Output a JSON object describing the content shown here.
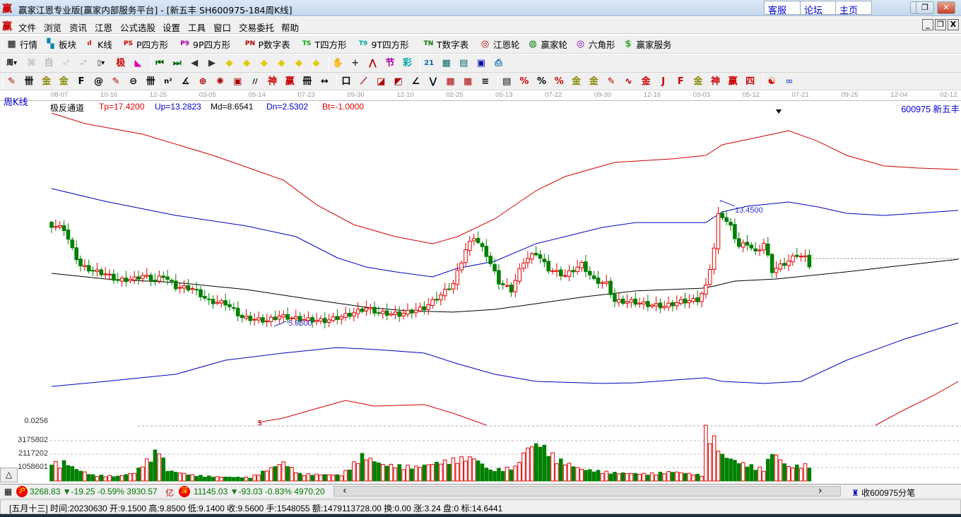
{
  "window": {
    "logo": "赢",
    "title": "赢家江恩专业版[赢家内部服务平台] - [新五丰  SH600975-184周K线]",
    "links": [
      "客服",
      "论坛",
      "主页"
    ],
    "controls": [
      "—",
      "❐",
      "✕"
    ]
  },
  "menu": {
    "logo": "赢",
    "items": [
      "文件",
      "浏览",
      "资讯",
      "江恩",
      "公式选股",
      "设置",
      "工具",
      "窗口",
      "交易委托",
      "帮助"
    ],
    "mdi": [
      "_",
      "❐",
      "X"
    ]
  },
  "toolbar1": [
    {
      "icon": "grid-icon",
      "glyph": "▦",
      "color": "#000",
      "label": "行情"
    },
    {
      "icon": "blocks-icon",
      "glyph": "▚",
      "color": "#08a",
      "label": "板块"
    },
    {
      "icon": "kline-icon",
      "glyph": "ıl",
      "color": "#c00",
      "label": "K线"
    },
    {
      "icon": "ps-icon",
      "glyph": "PS",
      "color": "#c00",
      "label": "P四方形"
    },
    {
      "icon": "p9-icon",
      "glyph": "P9",
      "color": "#a0a",
      "label": "9P四方形"
    },
    {
      "icon": "pn-icon",
      "glyph": "PN",
      "color": "#a00",
      "label": "P数字表"
    },
    {
      "icon": "ts-icon",
      "glyph": "TS",
      "color": "#0a0",
      "label": "T四方形"
    },
    {
      "icon": "t9-icon",
      "glyph": "T9",
      "color": "#0aa",
      "label": "9T四方形"
    },
    {
      "icon": "tn-icon",
      "glyph": "TN",
      "color": "#070",
      "label": "T数字表"
    },
    {
      "icon": "target-icon",
      "glyph": "◎",
      "color": "#a00",
      "label": "江恩轮"
    },
    {
      "icon": "wheel-icon",
      "glyph": "◍",
      "color": "#070",
      "label": "赢家轮"
    },
    {
      "icon": "hexagon-icon",
      "glyph": "◎",
      "color": "#70a",
      "label": "六角形"
    },
    {
      "icon": "dollar-icon",
      "glyph": "$",
      "color": "#3a3",
      "label": "赢家服务"
    }
  ],
  "toolbar2": [
    {
      "icon": "period-week-icon",
      "glyph": "周▾",
      "color": "#000"
    },
    {
      "icon": "disabled-icon",
      "glyph": "⌘",
      "color": "#bbb"
    },
    {
      "icon": "disabled-icon",
      "glyph": "自",
      "color": "#bbb"
    },
    {
      "icon": "disabled-icon",
      "glyph": "ₙ³",
      "color": "#bbb"
    },
    {
      "icon": "disabled-icon",
      "glyph": "ₙ⁹",
      "color": "#bbb"
    },
    {
      "icon": "candle-type-icon",
      "glyph": "▯▾",
      "color": "#000"
    },
    {
      "icon": "extreme-icon",
      "glyph": "极",
      "color": "#c00"
    },
    {
      "icon": "spectrum-icon",
      "glyph": "◣",
      "color": "#d0a"
    },
    {
      "icon": "first-icon",
      "glyph": "⏮",
      "color": "#060"
    },
    {
      "icon": "last-icon",
      "glyph": "⏭",
      "color": "#060"
    },
    {
      "icon": "left-icon",
      "glyph": "◀",
      "color": "#333"
    },
    {
      "icon": "right-icon",
      "glyph": "▶",
      "color": "#333"
    },
    {
      "icon": "diamond-left-icon",
      "glyph": "◆",
      "color": "#dc0"
    },
    {
      "icon": "diamond-right-icon",
      "glyph": "◆",
      "color": "#dc0"
    },
    {
      "icon": "diamond-expand-icon",
      "glyph": "◆",
      "color": "#dc0"
    },
    {
      "icon": "diamond-shrink-icon",
      "glyph": "◆",
      "color": "#dc0"
    },
    {
      "icon": "diamond-vshrink-icon",
      "glyph": "◆",
      "color": "#dc0"
    },
    {
      "icon": "diamond-move-icon",
      "glyph": "◆",
      "color": "#dc0"
    },
    {
      "icon": "hand-icon",
      "glyph": "✋",
      "color": "#333"
    },
    {
      "icon": "crosshair-icon",
      "glyph": "+",
      "color": "#333"
    },
    {
      "icon": "peak-icon",
      "glyph": "⋀",
      "color": "#a00"
    },
    {
      "icon": "section-icon",
      "glyph": "节",
      "color": "#a0a"
    },
    {
      "icon": "color-icon",
      "glyph": "彩",
      "color": "#0aa"
    },
    {
      "icon": "calendar-icon",
      "glyph": "21",
      "color": "#06a"
    },
    {
      "icon": "calculator-icon",
      "glyph": "▦",
      "color": "#066"
    },
    {
      "icon": "notes-icon",
      "glyph": "▤",
      "color": "#066"
    },
    {
      "icon": "save-icon",
      "glyph": "▣",
      "color": "#00a"
    },
    {
      "icon": "print-icon",
      "glyph": "⎙",
      "color": "#06a"
    }
  ],
  "toolbar3": [
    {
      "icon": "pen-icon",
      "glyph": "✎",
      "color": "#a00"
    },
    {
      "icon": "lines-icon",
      "glyph": "卌",
      "color": "#000"
    },
    {
      "icon": "gold-icon",
      "glyph": "金",
      "color": "#880"
    },
    {
      "icon": "gold2-icon",
      "glyph": "金",
      "color": "#880"
    },
    {
      "icon": "fib-icon",
      "glyph": "F",
      "color": "#000"
    },
    {
      "icon": "spiral-icon",
      "glyph": "@",
      "color": "#000"
    },
    {
      "icon": "pen2-icon",
      "glyph": "✎",
      "color": "#a00"
    },
    {
      "icon": "circle-scale-icon",
      "glyph": "⊖",
      "color": "#000"
    },
    {
      "icon": "lines2-icon",
      "glyph": "卌",
      "color": "#000"
    },
    {
      "icon": "n2-icon",
      "glyph": "n²",
      "color": "#000"
    },
    {
      "icon": "angle-icon",
      "glyph": "∡",
      "color": "#000"
    },
    {
      "icon": "cycle-icon",
      "glyph": "⊕",
      "color": "#a00"
    },
    {
      "icon": "radar-icon",
      "glyph": "✺",
      "color": "#a00"
    },
    {
      "icon": "square-icon",
      "glyph": "▣",
      "color": "#a00"
    },
    {
      "icon": "slash-icon",
      "glyph": "//",
      "color": "#000"
    },
    {
      "icon": "god-icon",
      "glyph": "神",
      "color": "#c00"
    },
    {
      "icon": "win-icon",
      "glyph": "赢",
      "color": "#c00"
    },
    {
      "icon": "comb-icon",
      "glyph": "冊",
      "color": "#000"
    },
    {
      "icon": "span-icon",
      "glyph": "↔",
      "color": "#000"
    },
    {
      "icon": "box-icon",
      "glyph": "口",
      "color": "#000"
    },
    {
      "icon": "fan-icon",
      "glyph": "⟋",
      "color": "#a00"
    },
    {
      "icon": "arc-icon",
      "glyph": "◪",
      "color": "#a00"
    },
    {
      "icon": "box-fan-icon",
      "glyph": "◩",
      "color": "#a00"
    },
    {
      "icon": "angle2-icon",
      "glyph": "∠",
      "color": "#000"
    },
    {
      "icon": "zigzag-icon",
      "glyph": "⋁",
      "color": "#000"
    },
    {
      "icon": "grid-icon",
      "glyph": "▦",
      "color": "#a00"
    },
    {
      "icon": "grid2-icon",
      "glyph": "▦",
      "color": "#a00"
    },
    {
      "icon": "parallel-icon",
      "glyph": "≡",
      "color": "#000"
    },
    {
      "icon": "table-icon",
      "glyph": "▤",
      "color": "#000"
    },
    {
      "icon": "pct-red-icon",
      "glyph": "%",
      "color": "#c00"
    },
    {
      "icon": "pct-icon",
      "glyph": "%",
      "color": "#000"
    },
    {
      "icon": "pct-lines-icon",
      "glyph": "%",
      "color": "#c00"
    },
    {
      "icon": "gold-circle-icon",
      "glyph": "金",
      "color": "#880"
    },
    {
      "icon": "gold-lines-icon",
      "glyph": "金",
      "color": "#880"
    },
    {
      "icon": "pen3-icon",
      "glyph": "✎",
      "color": "#a00"
    },
    {
      "icon": "wave-icon",
      "glyph": "∿",
      "color": "#a00"
    },
    {
      "icon": "gold-bar-icon",
      "glyph": "金",
      "color": "#c00"
    },
    {
      "icon": "j-fan-icon",
      "glyph": "J",
      "color": "#c00"
    },
    {
      "icon": "f-fan-icon",
      "glyph": "F",
      "color": "#c00"
    },
    {
      "icon": "gold-fan-icon",
      "glyph": "金",
      "color": "#880"
    },
    {
      "icon": "god-fan-icon",
      "glyph": "神",
      "color": "#c00"
    },
    {
      "icon": "win-fan-icon",
      "glyph": "赢",
      "color": "#c00"
    },
    {
      "icon": "four-fan-icon",
      "glyph": "四",
      "color": "#c00"
    },
    {
      "icon": "yinyang-icon",
      "glyph": "☯",
      "color": "#c00"
    },
    {
      "icon": "infinity-icon",
      "glyph": "∞",
      "color": "#36c"
    }
  ],
  "date_axis": [
    "08-07",
    "10-16",
    "12-25",
    "03-05",
    "05-14",
    "07-23",
    "09-30",
    "12-10",
    "02-25",
    "05-13",
    "07-22",
    "09-30",
    "12-16",
    "03-03",
    "05-12",
    "07-21",
    "09-25",
    "12-04",
    "02-12"
  ],
  "period_label": "周K线",
  "indicator": {
    "name": "极反通道",
    "tp": "Tp=17.4200",
    "up": "Up=13.2823",
    "md": "Md=8.6541",
    "dn": "Dn=2.5302",
    "bt": "Bt=-1.0000"
  },
  "stock": "600975  新五丰",
  "colors": {
    "up": "#e00000",
    "down": "#008000",
    "tp": "#d00000",
    "upline": "#0000c0",
    "md": "#000000"
  },
  "chart_data": {
    "type": "candlestick",
    "weeks": 184,
    "close_keypoints": [
      [
        0,
        12.0
      ],
      [
        3,
        11.8
      ],
      [
        5,
        10.5
      ],
      [
        7,
        9.5
      ],
      [
        10,
        9.2
      ],
      [
        13,
        9.0
      ],
      [
        16,
        8.6
      ],
      [
        20,
        8.7
      ],
      [
        22,
        8.9
      ],
      [
        25,
        8.6
      ],
      [
        27,
        8.9
      ],
      [
        30,
        8.2
      ],
      [
        34,
        8.1
      ],
      [
        38,
        7.3
      ],
      [
        42,
        7.2
      ],
      [
        46,
        6.3
      ],
      [
        52,
        6.1
      ],
      [
        55,
        6.4
      ],
      [
        60,
        6.2
      ],
      [
        66,
        6.1
      ],
      [
        72,
        6.5
      ],
      [
        76,
        6.9
      ],
      [
        79,
        6.6
      ],
      [
        84,
        6.5
      ],
      [
        90,
        6.9
      ],
      [
        94,
        7.7
      ],
      [
        97,
        8.4
      ],
      [
        100,
        10.5
      ],
      [
        102,
        11.3
      ],
      [
        105,
        10.2
      ],
      [
        108,
        8.5
      ],
      [
        111,
        8.0
      ],
      [
        114,
        9.8
      ],
      [
        117,
        10.3
      ],
      [
        120,
        9.3
      ],
      [
        124,
        8.9
      ],
      [
        128,
        9.6
      ],
      [
        131,
        8.6
      ],
      [
        134,
        8.4
      ],
      [
        136,
        7.3
      ],
      [
        140,
        7.3
      ],
      [
        144,
        7.1
      ],
      [
        148,
        7.0
      ],
      [
        152,
        7.3
      ],
      [
        156,
        7.4
      ],
      [
        158,
        8.2
      ],
      [
        160,
        10.6
      ],
      [
        161,
        12.6
      ],
      [
        162,
        12.6
      ],
      [
        164,
        11.9
      ],
      [
        166,
        10.7
      ],
      [
        168,
        10.9
      ],
      [
        170,
        10.3
      ],
      [
        172,
        10.9
      ],
      [
        174,
        9.2
      ],
      [
        176,
        9.5
      ],
      [
        178,
        9.8
      ],
      [
        180,
        10.2
      ],
      [
        182,
        10.0
      ],
      [
        183,
        9.56
      ]
    ],
    "volume_keypoints": [
      [
        0,
        1800000
      ],
      [
        2,
        1300000
      ],
      [
        3,
        1650000
      ],
      [
        6,
        1000000
      ],
      [
        10,
        500000
      ],
      [
        16,
        400000
      ],
      [
        20,
        700000
      ],
      [
        26,
        2800000
      ],
      [
        28,
        900000
      ],
      [
        34,
        500000
      ],
      [
        40,
        350000
      ],
      [
        48,
        300000
      ],
      [
        56,
        1600000
      ],
      [
        60,
        600000
      ],
      [
        70,
        500000
      ],
      [
        75,
        2200000
      ],
      [
        80,
        1400000
      ],
      [
        88,
        1200000
      ],
      [
        98,
        1900000
      ],
      [
        102,
        2000000
      ],
      [
        106,
        900000
      ],
      [
        112,
        1200000
      ],
      [
        115,
        2900000
      ],
      [
        118,
        3200000
      ],
      [
        122,
        1900000
      ],
      [
        128,
        1000000
      ],
      [
        136,
        700000
      ],
      [
        144,
        600000
      ],
      [
        150,
        800000
      ],
      [
        157,
        500000
      ],
      [
        158,
        4400000
      ],
      [
        160,
        3600000
      ],
      [
        162,
        2200000
      ],
      [
        166,
        1600000
      ],
      [
        172,
        1000000
      ],
      [
        174,
        2500000
      ],
      [
        178,
        1200000
      ],
      [
        183,
        1400000
      ]
    ],
    "lines": {
      "tp": [
        [
          0,
          18.95
        ],
        [
          8,
          18.3
        ],
        [
          22,
          17.64
        ],
        [
          39,
          16.33
        ],
        [
          56,
          14.8
        ],
        [
          64,
          13.28
        ],
        [
          73,
          12.05
        ],
        [
          83,
          11.31
        ],
        [
          92,
          10.87
        ],
        [
          98,
          11.31
        ],
        [
          107,
          12.4
        ],
        [
          117,
          14.15
        ],
        [
          124,
          15.02
        ],
        [
          136,
          15.9
        ],
        [
          150,
          16.12
        ],
        [
          158,
          16.33
        ],
        [
          162,
          16.99
        ],
        [
          170,
          17.42
        ],
        [
          178,
          17.86
        ],
        [
          185,
          17.21
        ],
        [
          192,
          16.33
        ],
        [
          201,
          15.68
        ],
        [
          209,
          15.55
        ],
        [
          219,
          15.46
        ]
      ],
      "up": [
        [
          0,
          14.28
        ],
        [
          13,
          13.49
        ],
        [
          30,
          12.62
        ],
        [
          47,
          11.97
        ],
        [
          59,
          11.31
        ],
        [
          69,
          10.0
        ],
        [
          76,
          9.43
        ],
        [
          83,
          9.13
        ],
        [
          92,
          8.82
        ],
        [
          98,
          9.35
        ],
        [
          107,
          9.78
        ],
        [
          117,
          10.87
        ],
        [
          133,
          11.88
        ],
        [
          141,
          12.18
        ],
        [
          151,
          12.18
        ],
        [
          158,
          12.18
        ],
        [
          162,
          12.84
        ],
        [
          168,
          13.19
        ],
        [
          178,
          13.45
        ],
        [
          185,
          13.15
        ],
        [
          192,
          12.75
        ],
        [
          201,
          12.62
        ],
        [
          209,
          12.75
        ],
        [
          219,
          12.93
        ]
      ],
      "md": [
        [
          0,
          9.04
        ],
        [
          13,
          8.69
        ],
        [
          30,
          8.47
        ],
        [
          47,
          8.04
        ],
        [
          64,
          7.38
        ],
        [
          76,
          6.94
        ],
        [
          86,
          6.72
        ],
        [
          97,
          6.64
        ],
        [
          107,
          6.81
        ],
        [
          117,
          7.16
        ],
        [
          129,
          7.6
        ],
        [
          141,
          7.95
        ],
        [
          157,
          8.12
        ],
        [
          160,
          8.25
        ],
        [
          165,
          8.56
        ],
        [
          175,
          8.69
        ],
        [
          192,
          9.13
        ],
        [
          202,
          9.43
        ],
        [
          219,
          9.91
        ]
      ],
      "dn": [
        [
          0,
          2.05
        ],
        [
          13,
          2.36
        ],
        [
          30,
          2.8
        ],
        [
          42,
          3.67
        ],
        [
          56,
          4.11
        ],
        [
          69,
          4.45
        ],
        [
          79,
          4.32
        ],
        [
          90,
          4.11
        ],
        [
          98,
          3.45
        ],
        [
          107,
          2.8
        ],
        [
          117,
          2.36
        ],
        [
          133,
          2.23
        ],
        [
          141,
          2.27
        ],
        [
          158,
          2.58
        ],
        [
          162,
          2.36
        ],
        [
          172,
          2.23
        ],
        [
          181,
          2.36
        ],
        [
          192,
          3.67
        ],
        [
          206,
          4.98
        ],
        [
          219,
          5.98
        ]
      ],
      "bt_a": [
        [
          50,
          -0.17
        ],
        [
          56,
          0.09
        ],
        [
          63,
          0.61
        ],
        [
          71,
          1.18
        ],
        [
          78,
          0.83
        ],
        [
          90,
          0.92
        ],
        [
          97,
          0.39
        ],
        [
          105,
          -0.35
        ]
      ],
      "bt_b": [
        [
          199,
          -0.35
        ],
        [
          206,
          0.61
        ],
        [
          213,
          1.49
        ],
        [
          219,
          2.36
        ]
      ]
    },
    "annotations": {
      "high": "13.4500",
      "low": "5.9500",
      "bottom_value": "0.0256",
      "dollar": "$"
    },
    "volume_ticks": [
      "3175802",
      "2117202",
      "1058601"
    ]
  },
  "volume_toggle": "△",
  "ticker": {
    "sh_badge": "沪",
    "sh": "3268.83 ▼-19.25 -0.59% 3930.57",
    "yi": "亿",
    "sz_badge": "深",
    "sz": "11145.03 ▼-93.03 -0.83% 4970.20",
    "scroll_left": "‹",
    "scroll_right": "›",
    "tick_label": "收600975分笔"
  },
  "status": "[五月十三] 时间:20230630 开:9.1500 高:9.8500 低:9.1400 收:9.5600 手:1548055 额:1479113728.00 换:0.00 涨:3.24 盘:0 标:14.6441"
}
